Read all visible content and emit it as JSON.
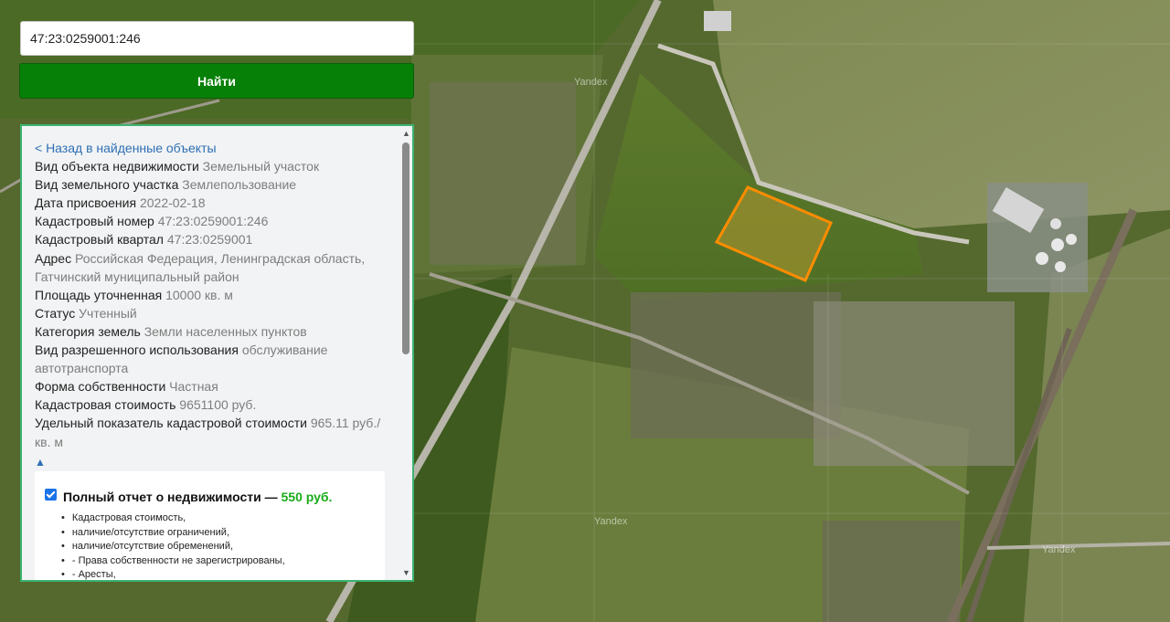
{
  "search": {
    "value": "47:23:0259001:246",
    "button_label": "Найти"
  },
  "panel": {
    "back_link": "< Назад в найденные объекты",
    "rows": [
      {
        "label": "Вид объекта недвижимости",
        "value": "Земельный участок"
      },
      {
        "label": "Вид земельного участка",
        "value": "Землепользование"
      },
      {
        "label": "Дата присвоения",
        "value": "2022-02-18"
      },
      {
        "label": "Кадастровый номер",
        "value": "47:23:0259001:246"
      },
      {
        "label": "Кадастровый квартал",
        "value": "47:23:0259001"
      },
      {
        "label": "Адрес",
        "value": "Российская Федерация, Ленинградская область, Гатчинский муниципальный район"
      },
      {
        "label": "Площадь уточненная",
        "value": "10000 кв. м"
      },
      {
        "label": "Статус",
        "value": "Учтенный"
      },
      {
        "label": "Категория земель",
        "value": "Земли населенных пунктов"
      },
      {
        "label": "Вид разрешенного использования",
        "value": "обслуживание автотранспорта"
      },
      {
        "label": "Форма собственности",
        "value": "Частная"
      },
      {
        "label": "Кадастровая стоимость",
        "value": "9651100 руб."
      },
      {
        "label": "Удельный показатель кадастровой стоимости",
        "value": "965.11 руб./кв. м"
      }
    ],
    "collapse_glyph": "▲",
    "report": {
      "checked": true,
      "title": "Полный отчет о недвижимости — ",
      "price": "550 руб.",
      "items": [
        "Кадастровая стоимость,",
        "наличие/отсутствие ограничений,",
        "наличие/отсутствие обременений,",
        "- Права собственности не зарегистрированы,",
        "- Аресты,"
      ]
    }
  },
  "map": {
    "watermark": "Yandex",
    "parcel_color": "#ff8c00",
    "search_button_color": "#078007",
    "panel_border_color": "#3cb371"
  }
}
